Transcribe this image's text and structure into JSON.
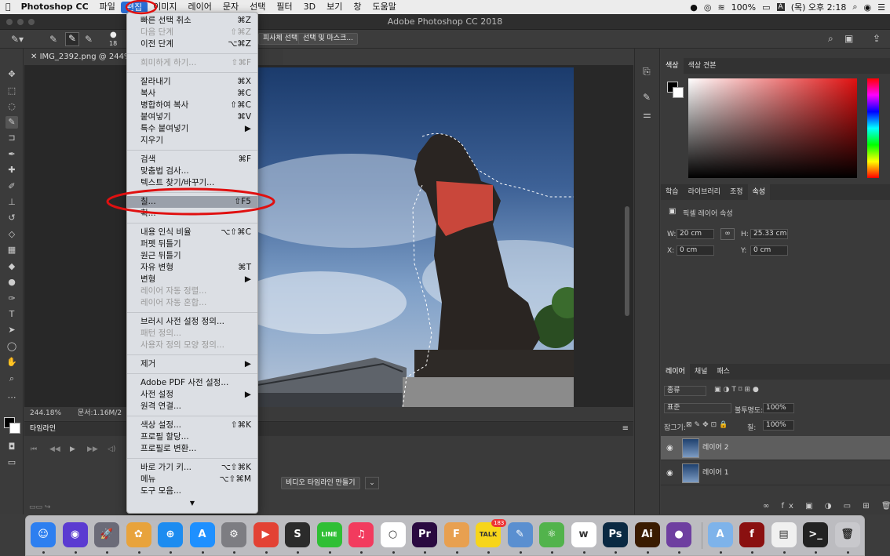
{
  "menubar": {
    "app": "Photoshop CC",
    "items": [
      "파일",
      "편집",
      "이미지",
      "레이어",
      "문자",
      "선택",
      "필터",
      "3D",
      "보기",
      "창",
      "도움말"
    ],
    "battery": "100%",
    "clock": "(목) 오후 2:18"
  },
  "window": {
    "title": "Adobe Photoshop CC 2018"
  },
  "options": {
    "brush_size": "18",
    "select_subject": "피사체 선택",
    "select_mask": "선택 및 마스크..."
  },
  "document": {
    "tab": "IMG_2392.png @ 244% (",
    "zoom": "244.18%",
    "docinfo": "문서:1.16M/2"
  },
  "edit_menu": {
    "items": [
      {
        "label": "빠른 선택 취소",
        "shortcut": "⌘Z",
        "disabled": false
      },
      {
        "label": "다음 단계",
        "shortcut": "⇧⌘Z",
        "disabled": true
      },
      {
        "label": "이전 단계",
        "shortcut": "⌥⌘Z",
        "disabled": false
      },
      {
        "sep": true
      },
      {
        "label": "희미하게 하기...",
        "shortcut": "⇧⌘F",
        "disabled": true
      },
      {
        "sep": true
      },
      {
        "label": "잘라내기",
        "shortcut": "⌘X",
        "disabled": false
      },
      {
        "label": "복사",
        "shortcut": "⌘C",
        "disabled": false
      },
      {
        "label": "병합하여 복사",
        "shortcut": "⇧⌘C",
        "disabled": false
      },
      {
        "label": "붙여넣기",
        "shortcut": "⌘V",
        "disabled": false
      },
      {
        "label": "특수 붙여넣기",
        "shortcut": "▶",
        "disabled": false
      },
      {
        "label": "지우기",
        "shortcut": "",
        "disabled": false
      },
      {
        "sep": true
      },
      {
        "label": "검색",
        "shortcut": "⌘F",
        "disabled": false
      },
      {
        "label": "맞춤법 검사...",
        "shortcut": "",
        "disabled": false
      },
      {
        "label": "텍스트 찾기/바꾸기...",
        "shortcut": "",
        "disabled": false
      },
      {
        "sep": true
      },
      {
        "label": "칠...",
        "shortcut": "⇧F5",
        "disabled": false,
        "highlight": true
      },
      {
        "label": "획...",
        "shortcut": "",
        "disabled": false
      },
      {
        "sep": true
      },
      {
        "label": "내용 인식 비율",
        "shortcut": "⌥⇧⌘C",
        "disabled": false
      },
      {
        "label": "퍼펫 뒤틀기",
        "shortcut": "",
        "disabled": false
      },
      {
        "label": "원근 뒤틀기",
        "shortcut": "",
        "disabled": false
      },
      {
        "label": "자유 변형",
        "shortcut": "⌘T",
        "disabled": false
      },
      {
        "label": "변형",
        "shortcut": "▶",
        "disabled": false
      },
      {
        "label": "레이어 자동 정렬...",
        "shortcut": "",
        "disabled": true
      },
      {
        "label": "레이어 자동 혼합...",
        "shortcut": "",
        "disabled": true
      },
      {
        "sep": true
      },
      {
        "label": "브러시 사전 설정 정의...",
        "shortcut": "",
        "disabled": false
      },
      {
        "label": "패턴 정의...",
        "shortcut": "",
        "disabled": true
      },
      {
        "label": "사용자 정의 모양 정의...",
        "shortcut": "",
        "disabled": true
      },
      {
        "sep": true
      },
      {
        "label": "제거",
        "shortcut": "▶",
        "disabled": false
      },
      {
        "sep": true
      },
      {
        "label": "Adobe PDF 사전 설정...",
        "shortcut": "",
        "disabled": false
      },
      {
        "label": "사전 설정",
        "shortcut": "▶",
        "disabled": false
      },
      {
        "label": "원격 연결...",
        "shortcut": "",
        "disabled": false
      },
      {
        "sep": true
      },
      {
        "label": "색상 설정...",
        "shortcut": "⇧⌘K",
        "disabled": false
      },
      {
        "label": "프로필 할당...",
        "shortcut": "",
        "disabled": false
      },
      {
        "label": "프로필로 변환...",
        "shortcut": "",
        "disabled": false
      },
      {
        "sep": true
      },
      {
        "label": "바로 가기 키...",
        "shortcut": "⌥⇧⌘K",
        "disabled": false
      },
      {
        "label": "메뉴",
        "shortcut": "⌥⇧⌘M",
        "disabled": false
      },
      {
        "label": "도구 모음...",
        "shortcut": "",
        "disabled": false
      }
    ]
  },
  "timeline": {
    "tab": "타임라인",
    "create_button": "비디오 타임라인 만들기"
  },
  "color_panel": {
    "tabs": [
      "색상",
      "색상 견본"
    ]
  },
  "props_panel": {
    "tabs": [
      "학습",
      "라이브러리",
      "조정",
      "속성"
    ],
    "title": "픽셀 레이어 속성",
    "w_label": "W:",
    "w": "20 cm",
    "h_label": "H:",
    "h": "25.33 cm",
    "x_label": "X:",
    "x": "0 cm",
    "y_label": "Y:",
    "y": "0 cm"
  },
  "layers_panel": {
    "tabs": [
      "레이어",
      "채널",
      "패스"
    ],
    "filter": "종류",
    "blend": "표준",
    "opacity_label": "불투명도:",
    "opacity": "100%",
    "lock_label": "잠그기:",
    "fill_label": "칠:",
    "fill": "100%",
    "layers": [
      "레이어 2",
      "레이어 1"
    ]
  },
  "dock": {
    "kakao_badge": "183",
    "apps": [
      {
        "name": "finder",
        "label": "☺",
        "color": "#2d7ff0"
      },
      {
        "name": "siri",
        "label": "◉",
        "color": "#5b3bd1"
      },
      {
        "name": "launchpad",
        "label": "🚀",
        "color": "#6b6b78"
      },
      {
        "name": "photos",
        "label": "✿",
        "color": "#e8a33c"
      },
      {
        "name": "safari",
        "label": "⊕",
        "color": "#1d8cf0"
      },
      {
        "name": "app-store",
        "label": "A",
        "color": "#1e90ff"
      },
      {
        "name": "system-preferences",
        "label": "⚙",
        "color": "#7d7d82"
      },
      {
        "name": "potplayer",
        "label": "▶",
        "color": "#e34234"
      },
      {
        "name": "scrivener",
        "label": "S",
        "color": "#2b2b2b"
      },
      {
        "name": "line",
        "label": "LINE",
        "color": "#2fbf35"
      },
      {
        "name": "music",
        "label": "♫",
        "color": "#f23b5e"
      },
      {
        "name": "clock-app",
        "label": "○",
        "color": "#ffffff"
      },
      {
        "name": "premiere",
        "label": "Pr",
        "color": "#2a0a40"
      },
      {
        "name": "finale",
        "label": "F",
        "color": "#e8a050"
      },
      {
        "name": "kakaotalk",
        "label": "TALK",
        "color": "#f7d51a"
      },
      {
        "name": "preview",
        "label": "✎",
        "color": "#5a8fd0"
      },
      {
        "name": "atom",
        "label": "⚛",
        "color": "#52b34c"
      },
      {
        "name": "whale",
        "label": "w",
        "color": "#ffffff"
      },
      {
        "name": "photoshop",
        "label": "Ps",
        "color": "#0a2942"
      },
      {
        "name": "illustrator",
        "label": "Ai",
        "color": "#3a1b00"
      },
      {
        "name": "github",
        "label": "●",
        "color": "#6e3fa0"
      },
      {
        "name": "applications-folder",
        "label": "A",
        "color": "#7eb3ea"
      },
      {
        "name": "flash",
        "label": "f",
        "color": "#8a1010"
      },
      {
        "name": "document",
        "label": "▤",
        "color": "#f0f0f0"
      },
      {
        "name": "terminal",
        "label": ">_",
        "color": "#222222"
      },
      {
        "name": "trash",
        "label": "🗑",
        "color": "#c8c8cc"
      }
    ]
  },
  "colors": {
    "accent": "#2a6fd6",
    "annotation": "#e01010"
  }
}
